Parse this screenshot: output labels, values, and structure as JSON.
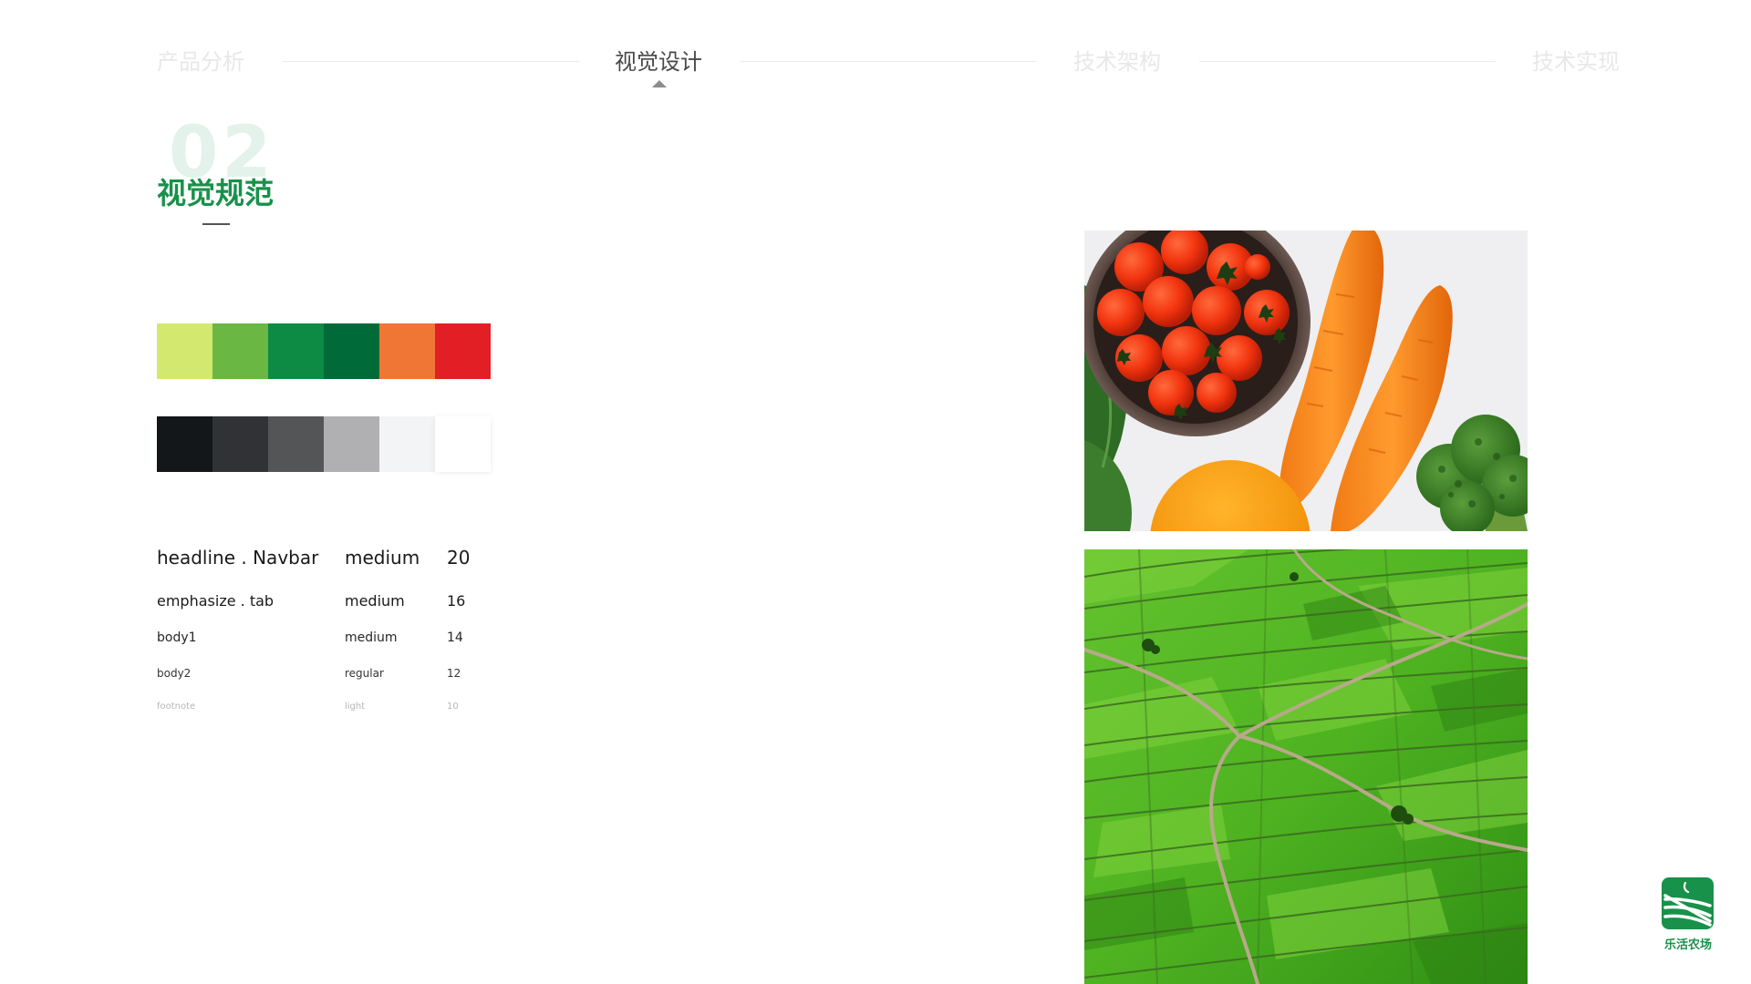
{
  "nav": {
    "tabs": [
      {
        "label": "产品分析",
        "active": false
      },
      {
        "label": "视觉设计",
        "active": true
      },
      {
        "label": "技术架构",
        "active": false
      },
      {
        "label": "技术实现",
        "active": false
      }
    ]
  },
  "section": {
    "number": "02",
    "title": "视觉规范"
  },
  "palettes": {
    "primary": [
      "#d2e86e",
      "#6ab744",
      "#0d8b45",
      "#006b38",
      "#ef7634",
      "#e21f24"
    ],
    "neutral": [
      "#131719",
      "#313236",
      "#545557",
      "#b0b0b2",
      "#f3f4f6",
      "#ffffff"
    ]
  },
  "typography": [
    {
      "name": "headline . Navbar",
      "weight": "medium",
      "size": "20"
    },
    {
      "name": "emphasize . tab",
      "weight": "medium",
      "size": "16"
    },
    {
      "name": "body1",
      "weight": "medium",
      "size": "14"
    },
    {
      "name": "body2",
      "weight": "regular",
      "size": "12"
    },
    {
      "name": "footnote",
      "weight": "light",
      "size": "10"
    }
  ],
  "brand": {
    "name": "乐活农场",
    "color": "#18914a"
  }
}
